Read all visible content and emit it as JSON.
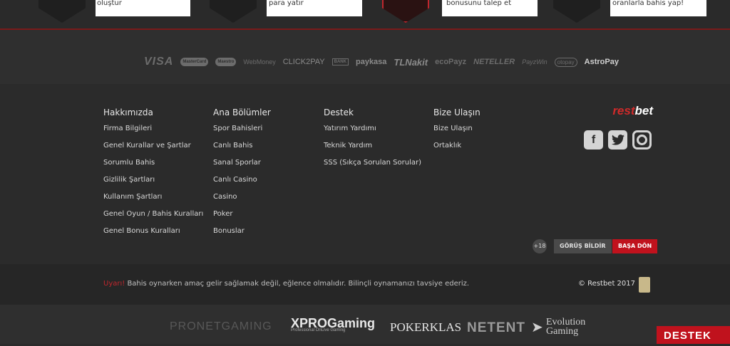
{
  "steps": [
    {
      "text": "oluştur"
    },
    {
      "text": "para yatır"
    },
    {
      "text": "bonusunu talep et"
    },
    {
      "text": "oranlarla bahis yap!"
    }
  ],
  "payments": [
    "VISA",
    "MasterCard",
    "Maestro",
    "WebMoney",
    "CLICK2PAY",
    "BANK",
    "paykasa",
    "TLNakit",
    "ecoPayz",
    "NETELLER",
    "PayzWin",
    "otopay",
    "AstroPay"
  ],
  "footer": {
    "columns": [
      {
        "title": "Hakkımızda",
        "items": [
          "Firma Bilgileri",
          "Genel Kurallar ve Şartlar",
          "Sorumlu Bahis",
          "Gizlilik Şartları",
          "Kullanım Şartları",
          "Genel Oyun / Bahis Kuralları",
          "Genel Bonus Kuralları"
        ]
      },
      {
        "title": "Ana Bölümler",
        "items": [
          "Spor Bahisleri",
          "Canlı Bahis",
          "Sanal Sporlar",
          "Canlı Casino",
          "Casino",
          "Poker",
          "Bonuslar"
        ]
      },
      {
        "title": "Destek",
        "items": [
          "Yatırım Yardımı",
          "Teknik Yardım",
          "SSS (Sıkça Sorulan Sorular)"
        ]
      },
      {
        "title": "Bize Ulaşın",
        "items": [
          "Bize Ulaşın",
          "Ortaklık"
        ]
      }
    ],
    "brand_part1": "rest",
    "brand_part2": "bet",
    "age_badge": "+18",
    "feedback_label": "GÖRÜŞ BİLDİR",
    "back_top_label": "BAŞA DÖN"
  },
  "warning": {
    "label": "Uyarı!",
    "text": " Bahis oynarken amaç gelir sağlamak değil, eğlence olmalıdır. Bilinçli oynamanızı tavsiye ederiz.",
    "copyright": "© Restbet 2017"
  },
  "providers": {
    "pronet": "PRONETGAMING",
    "xpro": "XPROGaming",
    "xpro_sub": "Professional OnLive Gaming",
    "poker": "POKERKLAS",
    "netent": "NETENT",
    "evo": "Evolution Gaming"
  },
  "support_label": "DESTEK",
  "colors": {
    "accent": "#c0121d",
    "background": "#2b2b2b"
  }
}
